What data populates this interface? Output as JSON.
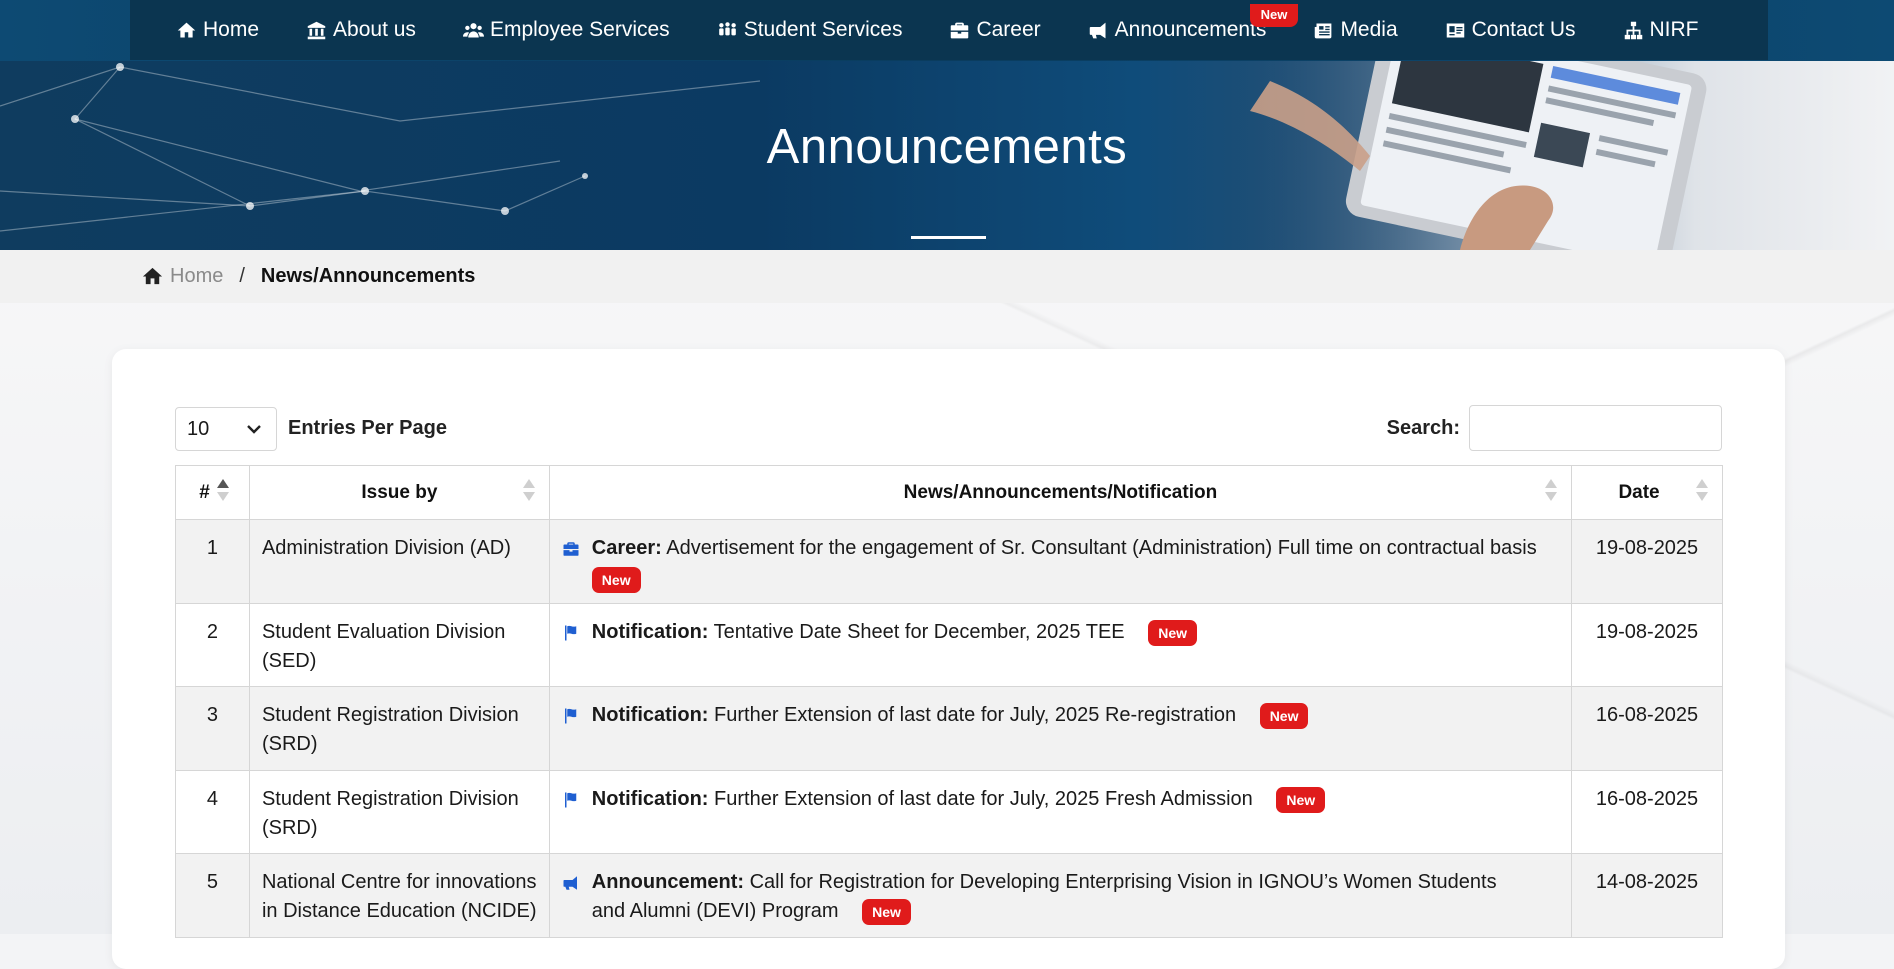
{
  "colors": {
    "nav_bg": "#0b3550",
    "badge_red": "#e01b1b",
    "icon_blue": "#1f5fd1"
  },
  "nav": {
    "items": [
      {
        "label": "Home",
        "icon": "home-icon"
      },
      {
        "label": "About us",
        "icon": "institution-icon"
      },
      {
        "label": "Employee Services",
        "icon": "users-icon"
      },
      {
        "label": "Student Services",
        "icon": "students-icon"
      },
      {
        "label": "Career",
        "icon": "briefcase-icon"
      },
      {
        "label": "Announcements",
        "icon": "megaphone-icon",
        "badge": "New"
      },
      {
        "label": "Media",
        "icon": "newspaper-icon"
      },
      {
        "label": "Contact Us",
        "icon": "contact-card-icon"
      },
      {
        "label": "NIRF",
        "icon": "sitemap-icon"
      }
    ]
  },
  "hero": {
    "title": "Announcements"
  },
  "breadcrumb": {
    "home": "Home",
    "separator": "/",
    "current": "News/Announcements"
  },
  "controls": {
    "entries_value": "10",
    "entries_label": "Entries Per Page",
    "search_label": "Search:",
    "search_value": ""
  },
  "table": {
    "columns": [
      "#",
      "Issue by",
      "News/Announcements/Notification",
      "Date"
    ],
    "rows": [
      {
        "num": "1",
        "issuer": "Administration Division (AD)",
        "icon": "briefcase-icon",
        "type": "Career:",
        "text": "Advertisement for the engagement of Sr. Consultant (Administration) Full time on contractual basis",
        "badge": "New",
        "date": "19-08-2025"
      },
      {
        "num": "2",
        "issuer": "Student Evaluation Division (SED)",
        "icon": "flag-icon",
        "type": "Notification:",
        "text": "Tentative Date Sheet for December, 2025 TEE",
        "badge": "New",
        "date": "19-08-2025"
      },
      {
        "num": "3",
        "issuer": "Student Registration Division (SRD)",
        "icon": "flag-icon",
        "type": "Notification:",
        "text": "Further Extension of last date for July, 2025 Re-registration",
        "badge": "New",
        "date": "16-08-2025"
      },
      {
        "num": "4",
        "issuer": "Student Registration Division (SRD)",
        "icon": "flag-icon",
        "type": "Notification:",
        "text": "Further Extension of last date for July, 2025 Fresh Admission",
        "badge": "New",
        "date": "16-08-2025"
      },
      {
        "num": "5",
        "issuer": "National Centre for innovations in Distance Education (NCIDE)",
        "icon": "megaphone-icon",
        "type": "Announcement:",
        "text": "Call for Registration for Developing Enterprising Vision in IGNOU’s Women Students and Alumni (DEVI) Program",
        "badge": "New",
        "date": "14-08-2025"
      }
    ]
  }
}
